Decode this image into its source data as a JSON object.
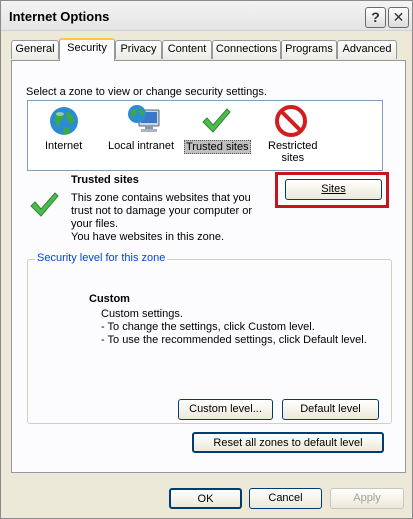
{
  "window": {
    "title": "Internet Options",
    "help_glyph": "?",
    "close_glyph": "✕"
  },
  "tabs": [
    {
      "label": "General"
    },
    {
      "label": "Security"
    },
    {
      "label": "Privacy"
    },
    {
      "label": "Content"
    },
    {
      "label": "Connections"
    },
    {
      "label": "Programs"
    },
    {
      "label": "Advanced"
    }
  ],
  "zones": {
    "instruction": "Select a zone to view or change security settings.",
    "items": [
      {
        "label": "Internet",
        "icon": "globe-icon"
      },
      {
        "label": "Local intranet",
        "icon": "computer-globe-icon"
      },
      {
        "label": "Trusted sites",
        "icon": "checkmark-icon"
      },
      {
        "label": "Restricted",
        "label2": "sites",
        "icon": "prohibited-icon"
      }
    ]
  },
  "zone_info": {
    "title": "Trusted sites",
    "desc_line1": "This zone contains websites that you",
    "desc_line2": "trust not to damage your computer or",
    "desc_line3": "your files.",
    "desc_line4": "You have websites in this zone.",
    "sites_button": "Sites"
  },
  "security_level": {
    "group_title": "Security level for this zone",
    "level_name": "Custom",
    "line1": "Custom settings.",
    "line2": "- To change the settings, click Custom level.",
    "line3": "- To use the recommended settings, click Default level.",
    "custom_level_button": "Custom level...",
    "default_level_button": "Default level"
  },
  "reset_button": "Reset all zones to default level",
  "footer": {
    "ok": "OK",
    "cancel": "Cancel",
    "apply": "Apply"
  },
  "colors": {
    "highlight": "#c8141e",
    "link_blue": "#0046d5",
    "active_tab_accent": "#ffc83c"
  }
}
